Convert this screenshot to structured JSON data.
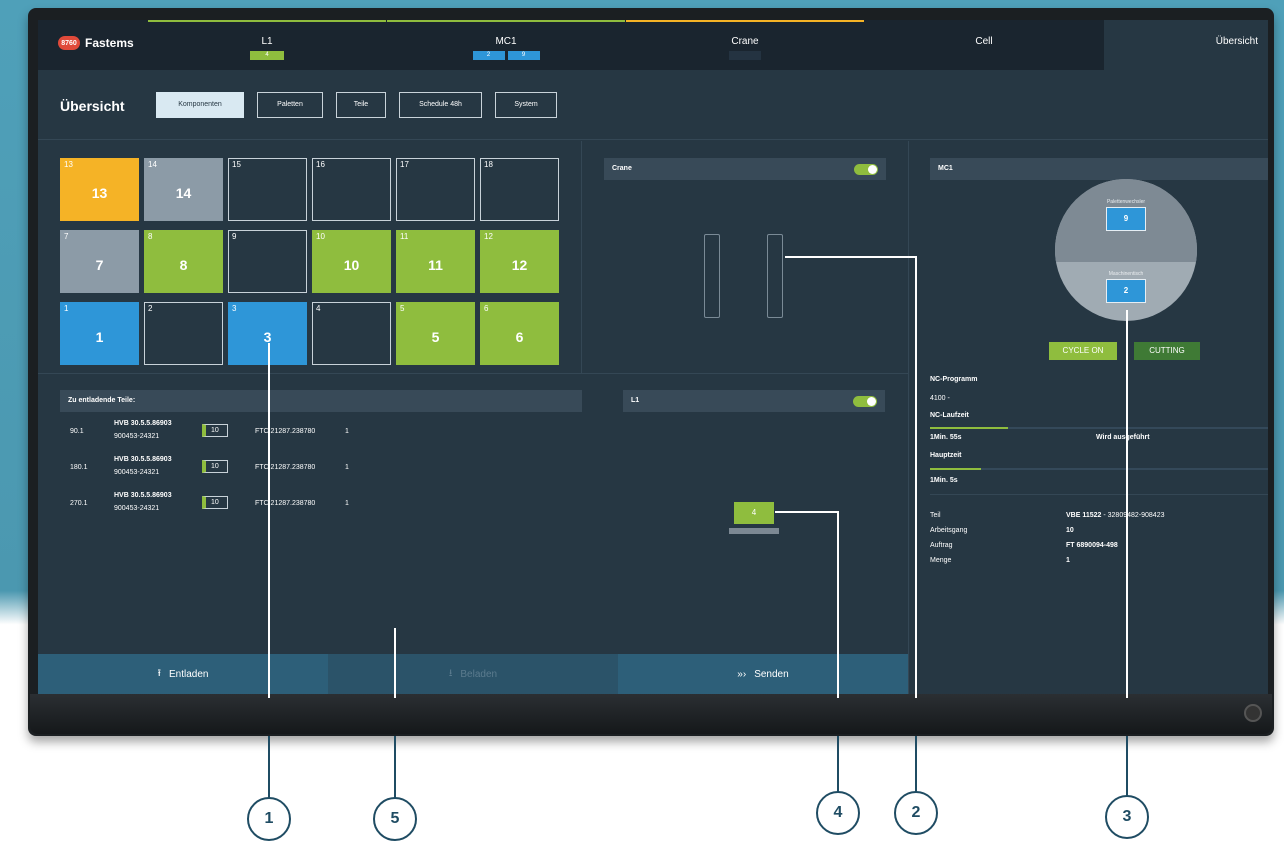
{
  "brand": {
    "badge": "8760",
    "name": "Fastems"
  },
  "topnav": {
    "tabs": [
      {
        "label": "L1",
        "chips": [
          "4"
        ]
      },
      {
        "label": "MC1",
        "chips": [
          "2",
          "9"
        ]
      },
      {
        "label": "Crane",
        "chips": [
          ""
        ]
      },
      {
        "label": "Cell",
        "chips": []
      },
      {
        "label": "Übersicht",
        "chips": []
      }
    ]
  },
  "page": {
    "title": "Übersicht",
    "buttons": [
      "Komponenten",
      "Paletten",
      "Teile",
      "Schedule 48h",
      "System"
    ]
  },
  "grid": {
    "slots": [
      {
        "n": "13",
        "big": "13",
        "state": "yellow"
      },
      {
        "n": "14",
        "big": "14",
        "state": "gray"
      },
      {
        "n": "15",
        "big": "",
        "state": "empty"
      },
      {
        "n": "16",
        "big": "",
        "state": "empty"
      },
      {
        "n": "17",
        "big": "",
        "state": "empty"
      },
      {
        "n": "18",
        "big": "",
        "state": "empty"
      },
      {
        "n": "7",
        "big": "7",
        "state": "gray"
      },
      {
        "n": "8",
        "big": "8",
        "state": "green"
      },
      {
        "n": "9",
        "big": "",
        "state": "empty"
      },
      {
        "n": "10",
        "big": "10",
        "state": "green"
      },
      {
        "n": "11",
        "big": "11",
        "state": "green"
      },
      {
        "n": "12",
        "big": "12",
        "state": "green"
      },
      {
        "n": "1",
        "big": "1",
        "state": "blue"
      },
      {
        "n": "2",
        "big": "",
        "state": "empty"
      },
      {
        "n": "3",
        "big": "3",
        "state": "blue"
      },
      {
        "n": "4",
        "big": "",
        "state": "empty"
      },
      {
        "n": "5",
        "big": "5",
        "state": "green"
      },
      {
        "n": "6",
        "big": "6",
        "state": "green"
      }
    ]
  },
  "crane": {
    "title": "Crane"
  },
  "unload": {
    "title": "Zu entladende Teile:",
    "rows": [
      {
        "pos": "90.1",
        "part": "HVB 30.5.5.86903",
        "code": "900453-24321",
        "qty": "10",
        "ftc": "FTC 21287.238780",
        "count": "1"
      },
      {
        "pos": "180.1",
        "part": "HVB 30.5.5.86903",
        "code": "900453-24321",
        "qty": "10",
        "ftc": "FTC 21287.238780",
        "count": "1"
      },
      {
        "pos": "270.1",
        "part": "HVB 30.5.5.86903",
        "code": "900453-24321",
        "qty": "10",
        "ftc": "FTC 21287.238780",
        "count": "1"
      }
    ]
  },
  "l1": {
    "title": "L1",
    "pallet": "4"
  },
  "mc1": {
    "title": "MC1",
    "changer_label": "Palettenwechsler",
    "changer_value": "9",
    "table_label": "Maschinentisch",
    "table_value": "2",
    "btn_cycle": "CYCLE ON",
    "btn_cutting": "CUTTING",
    "nc_program_label": "NC-Programm",
    "nc_program_value": "4100 -",
    "nc_runtime_label": "NC-Laufzeit",
    "nc_runtime_value": "1Min. 55s",
    "nc_runtime_progress": 0.23,
    "status": "Wird ausgeführt",
    "main_time_label": "Hauptzeit",
    "main_time_value": "1Min. 5s",
    "main_time_progress": 0.15,
    "details": [
      {
        "k": "Teil",
        "v_bold": "VBE 11522",
        "v_rest": " - 32809482-908423"
      },
      {
        "k": "Arbeitsgang",
        "v_bold": "10",
        "v_rest": ""
      },
      {
        "k": "Auftrag",
        "v_bold": "FT 6890094-498",
        "v_rest": ""
      },
      {
        "k": "Menge",
        "v_bold": "1",
        "v_rest": ""
      }
    ]
  },
  "actions": {
    "unload": "Entladen",
    "load": "Beladen",
    "send": "Senden"
  },
  "callouts": [
    "1",
    "5",
    "4",
    "2",
    "3"
  ],
  "colors": {
    "green": "#8fbd3e",
    "blue": "#2e96d8",
    "yellow": "#f5b326",
    "gray": "#8c9ba7",
    "screen": "#263743"
  }
}
